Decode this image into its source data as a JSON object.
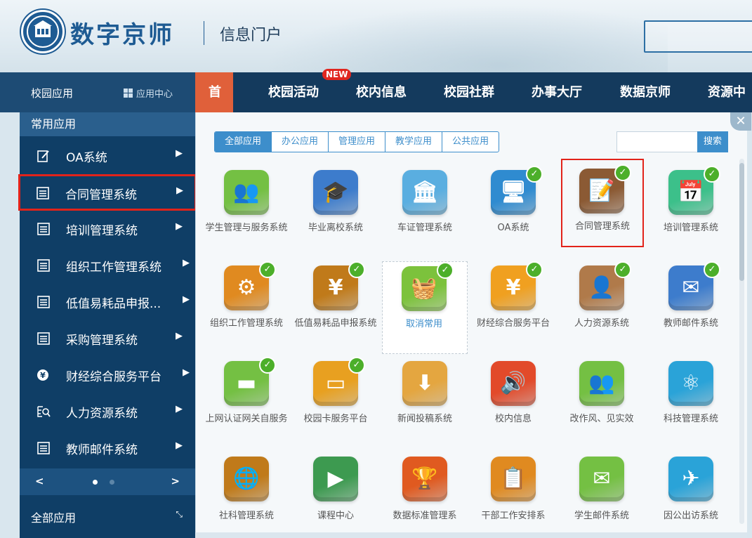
{
  "header": {
    "brand": "数字京师",
    "subtitle": "信息门户"
  },
  "nav": {
    "apps_label": "校园应用",
    "app_center": "应用中心",
    "new_badge": "NEW",
    "items": [
      "首页",
      "校园活动",
      "校内信息",
      "校园社群",
      "办事大厅",
      "数据京师",
      "资源中"
    ]
  },
  "sidebar": {
    "title": "常用应用",
    "items": [
      {
        "label": "OA系统",
        "icon": "edit-icon"
      },
      {
        "label": "合同管理系统",
        "icon": "list-icon"
      },
      {
        "label": "培训管理系统",
        "icon": "list-icon"
      },
      {
        "label": "组织工作管理系统",
        "icon": "list-icon"
      },
      {
        "label": "低值易耗品申报...",
        "icon": "list-icon"
      },
      {
        "label": "采购管理系统",
        "icon": "list-icon"
      },
      {
        "label": "财经综合服务平台",
        "icon": "finance-icon"
      },
      {
        "label": "人力资源系统",
        "icon": "people-search-icon"
      },
      {
        "label": "教师邮件系统",
        "icon": "list-icon"
      }
    ],
    "pager_prev": "<",
    "pager_next": ">",
    "all_apps": "全部应用",
    "expand": "⤡"
  },
  "panel": {
    "tabs": [
      "全部应用",
      "办公应用",
      "管理应用",
      "教学应用",
      "公共应用"
    ],
    "active_tab": "全部应用",
    "search_button": "搜索",
    "close": "✕",
    "apps": [
      {
        "name": "学生管理与服务系统",
        "icon": "students-icon",
        "color": "#74c043",
        "checked": false
      },
      {
        "name": "毕业离校系统",
        "icon": "graduation-cap-icon",
        "color": "#3d7ccc",
        "checked": false
      },
      {
        "name": "车证管理系统",
        "icon": "app-building-icon",
        "color": "#5aaee0",
        "checked": false
      },
      {
        "name": "OA系统",
        "icon": "monitor-pen-icon",
        "color": "#2f8bd0",
        "checked": true
      },
      {
        "name": "合同管理系统",
        "icon": "contract-icon",
        "color": "#8b5a34",
        "checked": true
      },
      {
        "name": "培训管理系统",
        "icon": "calendar-icon",
        "color": "#3cc08a",
        "checked": true
      },
      {
        "name": "组织工作管理系统",
        "icon": "org-chart-icon",
        "color": "#e08a20",
        "checked": true
      },
      {
        "name": "低值易耗品申报系统",
        "icon": "yuan-coin-icon",
        "color": "#c07a1a",
        "checked": true
      },
      {
        "name": "取消常用",
        "icon": "basket-icon",
        "color": "#7cc23c",
        "checked": true
      },
      {
        "name": "财经综合服务平台",
        "icon": "yuan-icon",
        "color": "#f0a020",
        "checked": true
      },
      {
        "name": "人力资源系统",
        "icon": "hr-person-icon",
        "color": "#b07a4a",
        "checked": true
      },
      {
        "name": "教师邮件系统",
        "icon": "mail-person-icon",
        "color": "#3d7ccc",
        "checked": true
      },
      {
        "name": "上网认证网关自服务",
        "icon": "router-icon",
        "color": "#74c043",
        "checked": true
      },
      {
        "name": "校园卡服务平台",
        "icon": "card-icon",
        "color": "#e8a020",
        "checked": true
      },
      {
        "name": "新闻投稿系统",
        "icon": "download-box-icon",
        "color": "#e4a640",
        "checked": false
      },
      {
        "name": "校内信息",
        "icon": "speaker-icon",
        "color": "#e24a2a",
        "checked": false
      },
      {
        "name": "改作风、见实效",
        "icon": "team-icon",
        "color": "#74c043",
        "checked": false
      },
      {
        "name": "科技管理系统",
        "icon": "atom-icon",
        "color": "#2aa3d8",
        "checked": false
      },
      {
        "name": "社科管理系统",
        "icon": "globe-icon",
        "color": "#c07a1a",
        "checked": false
      },
      {
        "name": "课程中心",
        "icon": "play-board-icon",
        "color": "#3d9a50",
        "checked": false
      },
      {
        "name": "数据标准管理系",
        "icon": "trophy-icon",
        "color": "#e05a20",
        "checked": false
      },
      {
        "name": "干部工作安排系",
        "icon": "clipboard-icon",
        "color": "#e08a20",
        "checked": false
      },
      {
        "name": "学生邮件系统",
        "icon": "mail-student-icon",
        "color": "#74c043",
        "checked": false
      },
      {
        "name": "因公出访系统",
        "icon": "airplane-globe-icon",
        "color": "#2aa3d8",
        "checked": false
      }
    ]
  }
}
